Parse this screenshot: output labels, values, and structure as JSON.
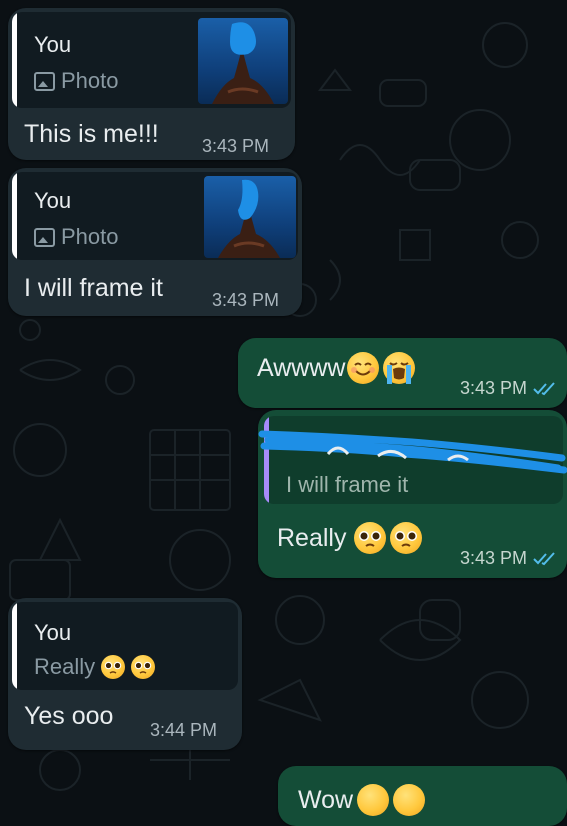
{
  "colors": {
    "background": "#0b1014",
    "incoming_bubble": "#1f2c33",
    "outgoing_bubble": "#144d37",
    "quote_bar_self": "#ffffff",
    "quote_bar_other": "#a78bfa",
    "read_ticks": "#53bdeb",
    "censor_scribble": "#1e8fe6"
  },
  "chat": {
    "messages": [
      {
        "direction": "incoming",
        "quote": {
          "sender": "You",
          "type_icon": "photo-icon",
          "text": "Photo",
          "has_thumbnail": true
        },
        "text": "This is me!!!",
        "time": "3:43 PM"
      },
      {
        "direction": "incoming",
        "quote": {
          "sender": "You",
          "type_icon": "photo-icon",
          "text": "Photo",
          "has_thumbnail": true
        },
        "text": "I will frame it",
        "time": "3:43 PM"
      },
      {
        "direction": "outgoing",
        "text": "Awwww",
        "emojis": [
          "smiling-face-icon",
          "loudly-crying-face-icon"
        ],
        "time": "3:43 PM",
        "status_icon": "double-check-icon"
      },
      {
        "direction": "outgoing",
        "quote": {
          "sender_redacted": true,
          "text": "I will frame it"
        },
        "text": "Really",
        "emojis": [
          "pleading-face-icon",
          "pleading-face-icon"
        ],
        "time": "3:43 PM",
        "status_icon": "double-check-icon"
      },
      {
        "direction": "incoming",
        "quote": {
          "sender": "You",
          "text": "Really",
          "emojis": [
            "pleading-face-icon",
            "pleading-face-icon"
          ]
        },
        "text": "Yes ooo",
        "time": "3:44 PM"
      },
      {
        "direction": "outgoing",
        "text": "Wow",
        "partial": true,
        "emojis": [
          "grinning-face-icon",
          "relieved-face-icon"
        ]
      }
    ]
  }
}
